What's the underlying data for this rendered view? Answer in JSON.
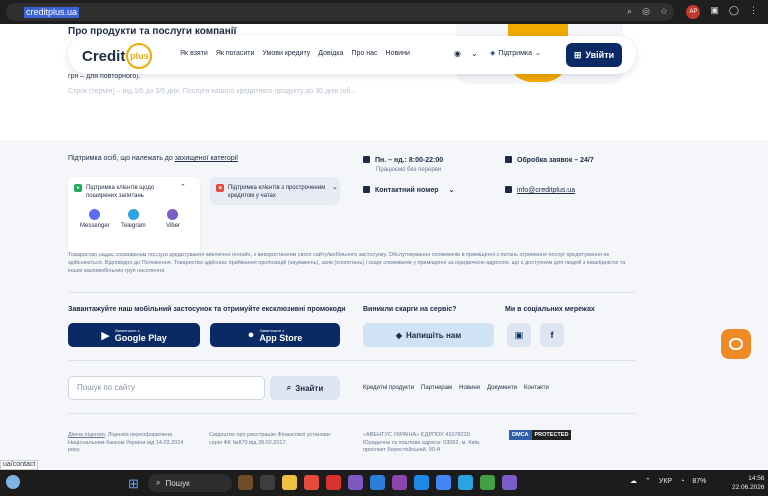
{
  "browser": {
    "url": "creditplus.ua",
    "extension_badge": "AP"
  },
  "background": {
    "heading": "Про продукти та послуги компанії",
    "text_fragment": "грн – для повторного).",
    "text_faded": "Строк (термін) – від 1/5 до 3/5 дня. Послуги вашого кредитного продукту до 30 днів (об..."
  },
  "header": {
    "logo_text": "Credit",
    "logo_badge": "plus",
    "nav": [
      "Як взяти",
      "Як погасити",
      "Умови кредиту",
      "Довідка",
      "Про нас",
      "Новини"
    ],
    "support_label": "Підтримка",
    "login_label": "Увійти"
  },
  "footer": {
    "protected_prefix": "Підтримка осіб, що належать до ",
    "protected_link": "захищеної категорії",
    "card1_title": "Підтримка клієнтів щодо поширених запитань",
    "messengers": [
      "Messenger",
      "Telegram",
      "Viber"
    ],
    "card2_title": "Підтримка клієнтів з простроченим кредитом у чатах",
    "hours": "Пн. – нд.: 8:00-22:00",
    "hours_sub": "Працюємо без перерви",
    "contact_number": "Контактний номер",
    "processing": "Обробка заявок – 24/7",
    "email": "info@creditplus.ua",
    "disclaimer": "Товариство надає споживачам послуги кредитування виключно онлайн, з використанням свого сайту/мобільного застосунку. Обслуговування споживачів в приміщенні з питань отримання послуг кредитування не здійснюється. Відповідно до Положення, Товариство здійснює приймання пропозицій (зауважень), заяв (клопотань) і скарг споживачів у приміщенні за юридичною адресою, що є доступним для людей з інвалідністю та інших маломобільних груп населення.",
    "app_title": "Завантажуйте наш мобільний застосунок та отримуйте ексклюзивні промокоди",
    "google_small": "Завантажте з",
    "google_big": "Google Play",
    "apple_small": "Завантажте з",
    "apple_big": "App Store",
    "complaints_title": "Виникли скарги на сервіс?",
    "write_label": "Напишіть нам",
    "social_title": "Ми в соціальних мережах",
    "search_placeholder": "Пошук по сайту",
    "search_button": "Знайти",
    "links": [
      "Кредитні продукти",
      "Партнерам",
      "Новини",
      "Документи",
      "Контакти"
    ],
    "license_link": "Діюча ліцензія",
    "license_text": ", Ліцензія переоформлена Національним банком України від 14.03.2024 року.",
    "registration_text": "Свідоцтво про реєстрацію Фінансової установи серія ФК №870 від 28.02.2017.",
    "company_text": "«АВЕНТУС УКРАЇНА» ЄДРПОУ 41078230. Юридична та поштова адреса: 03062, м. Київ, проспект Берестейський, 90-А",
    "dmca_left": "DMCA",
    "dmca_right": "PROTECTED"
  },
  "status_tip": "ua/contact",
  "taskbar": {
    "search": "Пошук",
    "lang": "УКР",
    "battery": "87%",
    "time": "14:56",
    "date": "22.06.2026"
  }
}
